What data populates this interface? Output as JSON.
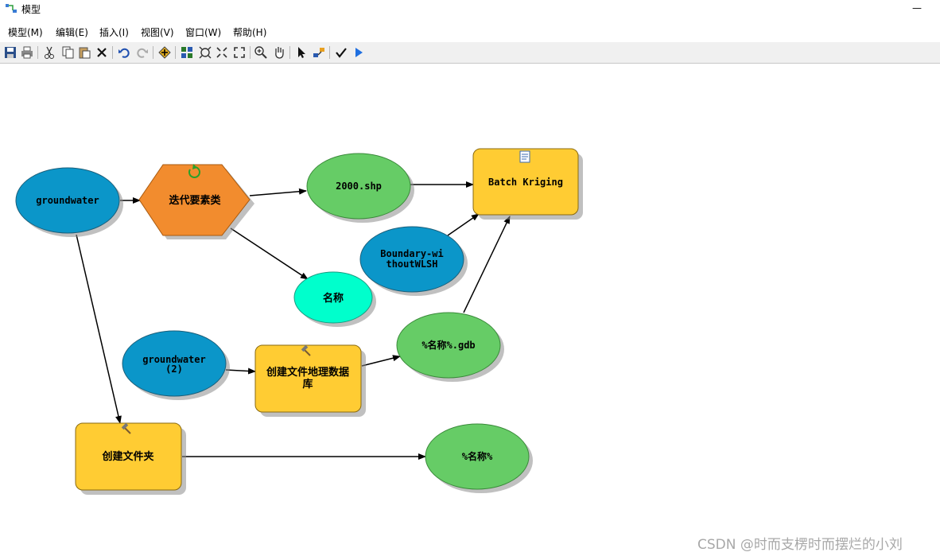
{
  "window": {
    "title": "模型",
    "minimize_glyph": "—"
  },
  "menu": [
    {
      "label": "模型(M)"
    },
    {
      "label": "编辑(E)"
    },
    {
      "label": "插入(I)"
    },
    {
      "label": "视图(V)"
    },
    {
      "label": "窗口(W)"
    },
    {
      "label": "帮助(H)"
    }
  ],
  "toolbar_icons": [
    "save-icon",
    "print-icon",
    "cut-icon",
    "copy-icon",
    "paste-icon",
    "delete-icon",
    "undo-icon",
    "redo-icon",
    "add-data-icon",
    "auto-layout-icon",
    "full-extent-icon",
    "zoom-in-fixed-icon",
    "zoom-out-fixed-icon",
    "zoom-in-icon",
    "pan-icon",
    "select-icon",
    "connect-icon",
    "validate-icon",
    "run-icon"
  ],
  "nodes": {
    "groundwater": "groundwater",
    "iterate": "迭代要素类",
    "shp2000": "2000.shp",
    "batch_kriging": "Batch Kriging",
    "boundary_line1": "Boundary-wi",
    "boundary_line2": "thoutWLSH",
    "name": "名称",
    "groundwater2_line1": "groundwater",
    "groundwater2_line2": "(2)",
    "create_gdb_line1": "创建文件地理数据",
    "create_gdb_line2": "库",
    "gdb_output": "%名称%.gdb",
    "create_folder": "创建文件夹",
    "folder_output": "%名称%"
  },
  "colors": {
    "input_data": "#0b96c9",
    "iterator": "#f28c2e",
    "derived_data": "#66cc66",
    "parameter": "#00ffcc",
    "tool": "#ffcc33"
  },
  "watermark": "CSDN @时而支楞时而摆烂的小刘"
}
